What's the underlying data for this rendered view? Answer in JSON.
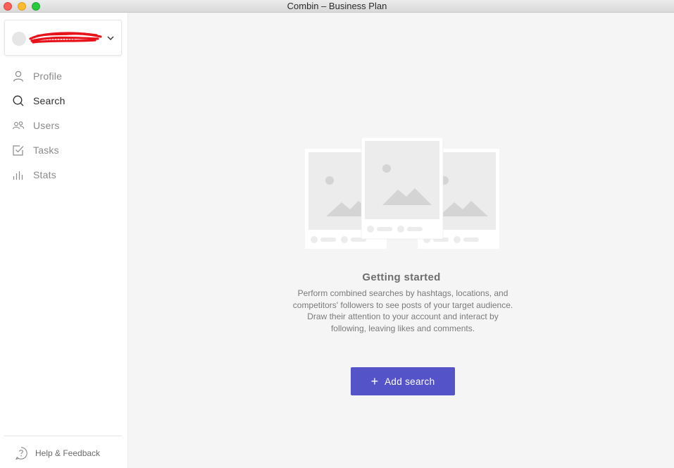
{
  "window": {
    "title": "Combin – Business Plan"
  },
  "account": {
    "name": "················"
  },
  "sidebar": {
    "items": [
      {
        "label": "Profile",
        "icon": "user-icon"
      },
      {
        "label": "Search",
        "icon": "search-icon"
      },
      {
        "label": "Users",
        "icon": "users-icon"
      },
      {
        "label": "Tasks",
        "icon": "task-check-icon"
      },
      {
        "label": "Stats",
        "icon": "stats-bars-icon"
      }
    ],
    "help_label": "Help & Feedback"
  },
  "main": {
    "title": "Getting started",
    "description": "Perform combined searches by hashtags, locations, and competitors' followers to see posts of your target audience. Draw their attention to your account and interact by following, leaving likes and comments.",
    "button_label": "Add search"
  },
  "colors": {
    "accent": "#5454c8",
    "background": "#f5f5f5",
    "sidebar": "#ffffff"
  }
}
